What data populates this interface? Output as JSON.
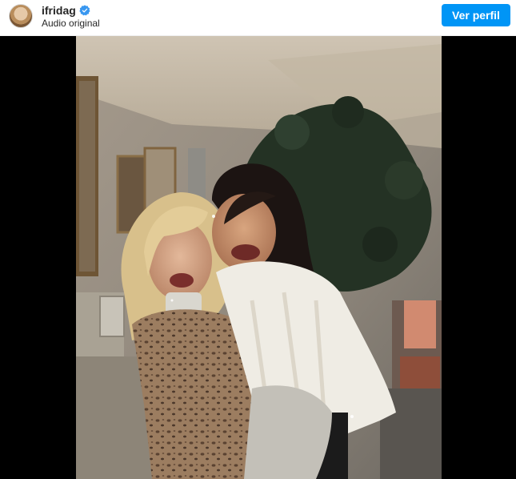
{
  "header": {
    "username": "ifridag",
    "verified_icon": "verified-badge-icon",
    "subtitle": "Audio original",
    "profile_button_label": "Ver perfil"
  },
  "video": {
    "description_icon": "video-frame"
  },
  "colors": {
    "accent": "#0095f6",
    "verified": "#3897f0",
    "video_background": "#000000"
  }
}
